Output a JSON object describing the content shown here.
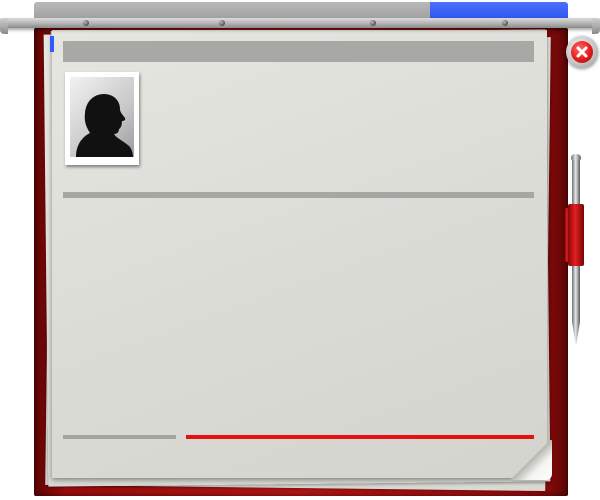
{
  "window": {
    "close_icon": "close-icon",
    "accent_color": "#2f5bff",
    "folder_color": "#b51616",
    "progress_color": "#e61010"
  },
  "profile": {
    "avatar_icon": "person-silhouette-icon"
  },
  "decor": {
    "pen_icon": "pen-icon"
  }
}
